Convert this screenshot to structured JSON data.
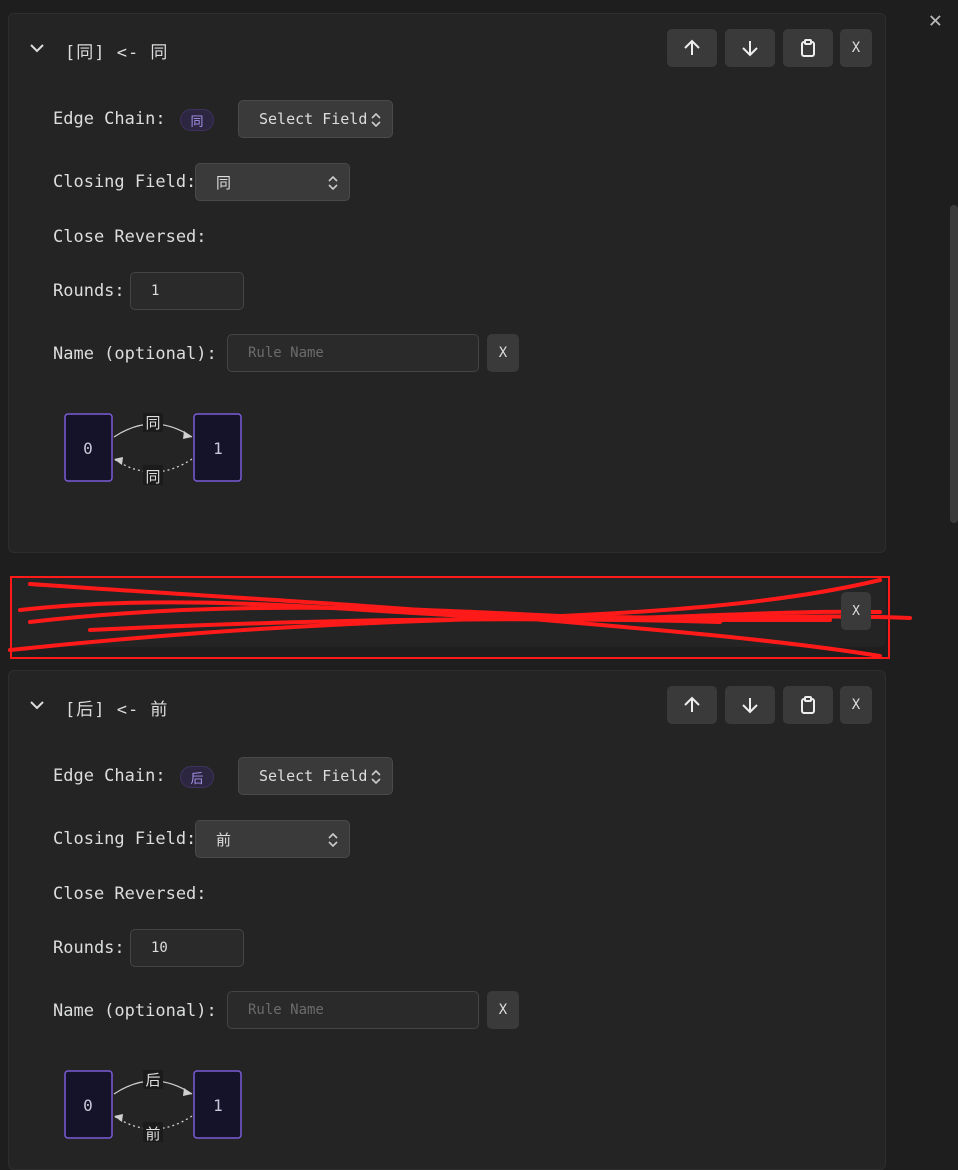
{
  "window": {
    "close_glyph": "✕"
  },
  "rules": [
    {
      "title": "[同] <- 同",
      "edge_chain_label": "Edge Chain:",
      "edge_chain_pill": "同",
      "edge_chain_select": "Select Field",
      "closing_field_label": "Closing Field:",
      "closing_field_value": "同",
      "close_reversed_label": "Close Reversed:",
      "rounds_label": "Rounds:",
      "rounds_value": "1",
      "name_label": "Name (optional):",
      "name_placeholder": "Rule Name",
      "clear_label": "X",
      "delete_label": "X",
      "diagram": {
        "node_a": "0",
        "node_b": "1",
        "forward_edge": "同",
        "closing_edge": "同"
      }
    },
    {
      "title": "[后] <- 前",
      "edge_chain_label": "Edge Chain:",
      "edge_chain_pill": "后",
      "edge_chain_select": "Select Field",
      "closing_field_label": "Closing Field:",
      "closing_field_value": "前",
      "close_reversed_label": "Close Reversed:",
      "rounds_label": "Rounds:",
      "rounds_value": "10",
      "name_label": "Name (optional):",
      "name_placeholder": "Rule Name",
      "clear_label": "X",
      "delete_label": "X",
      "diagram": {
        "node_a": "0",
        "node_b": "1",
        "forward_edge": "后",
        "closing_edge": "前"
      }
    }
  ],
  "collapsed_rule": {
    "delete_label": "X"
  },
  "icons": {
    "collapse": "chevron-down-icon",
    "move_up": "arrow-up-icon",
    "move_down": "arrow-down-icon",
    "copy": "clipboard-icon",
    "select_arrows": "chevron-up-down-icon"
  },
  "colors": {
    "background": "#1e1e1e",
    "card": "#242424",
    "button": "#3a3a3a",
    "node_stroke": "#7b5cd6",
    "node_fill": "#14132a",
    "pill_text": "#a690e8",
    "redaction": "#ff1a1a"
  }
}
